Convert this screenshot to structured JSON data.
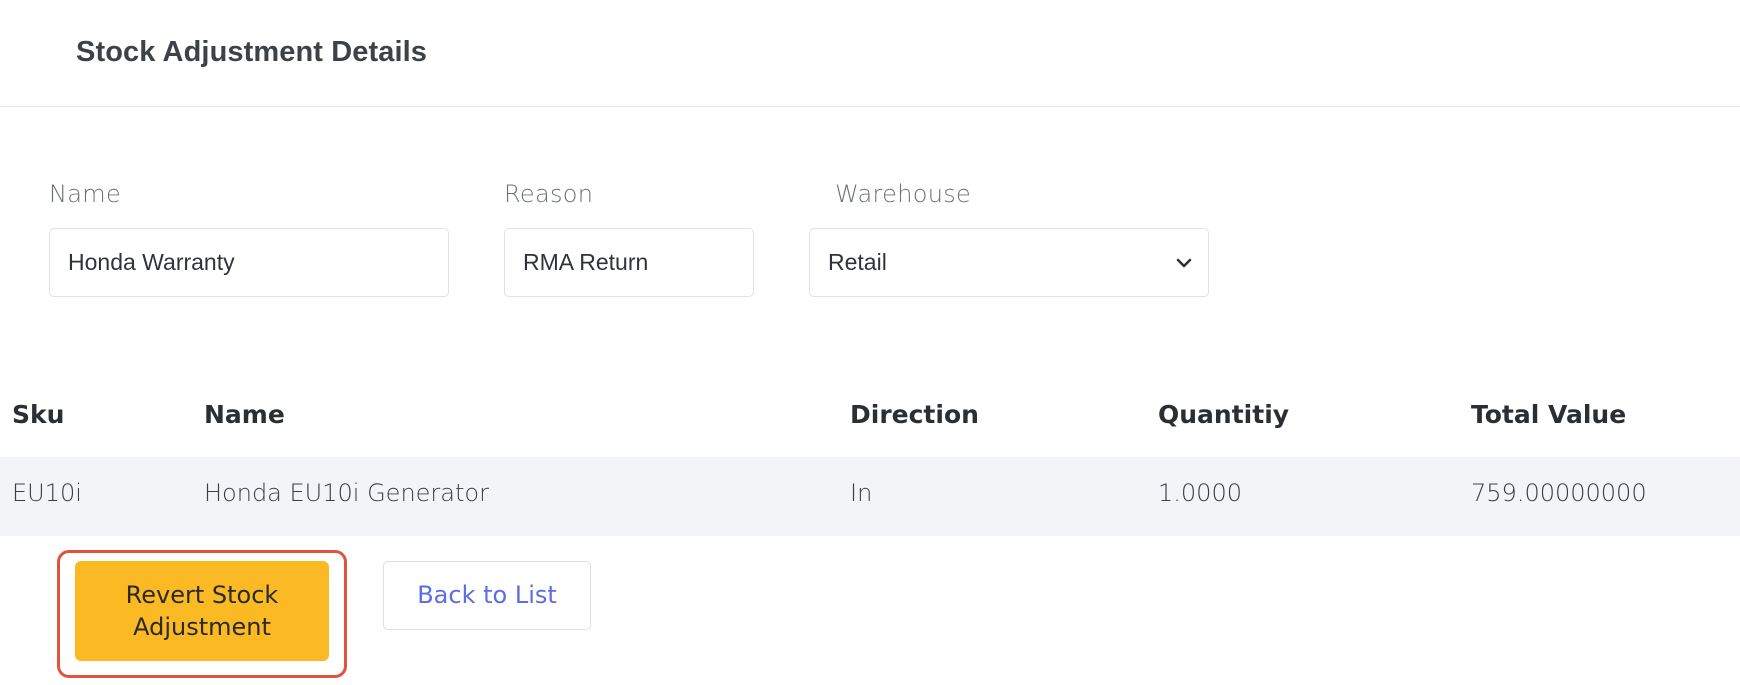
{
  "header": {
    "title": "Stock Adjustment Details"
  },
  "form": {
    "name": {
      "label": "Name",
      "value": "Honda Warranty"
    },
    "reason": {
      "label": "Reason",
      "value": "RMA Return"
    },
    "warehouse": {
      "label": "Warehouse",
      "value": "Retail",
      "icon": "chevron-down-icon"
    }
  },
  "table": {
    "columns": [
      "Sku",
      "Name",
      "Direction",
      "Quantitiy",
      "Total Value"
    ],
    "rows": [
      [
        "EU10i",
        "Honda EU10i Generator",
        "In",
        "1.0000",
        "759.00000000"
      ]
    ]
  },
  "actions": {
    "revert_line1": "Revert Stock",
    "revert_line2": "Adjustment",
    "back_label": "Back to List"
  },
  "colors": {
    "revert_button": "#fbb924",
    "highlight_outline": "#e0533d",
    "link_text": "#5c6ee4",
    "row_background": "#f3f4f7"
  }
}
